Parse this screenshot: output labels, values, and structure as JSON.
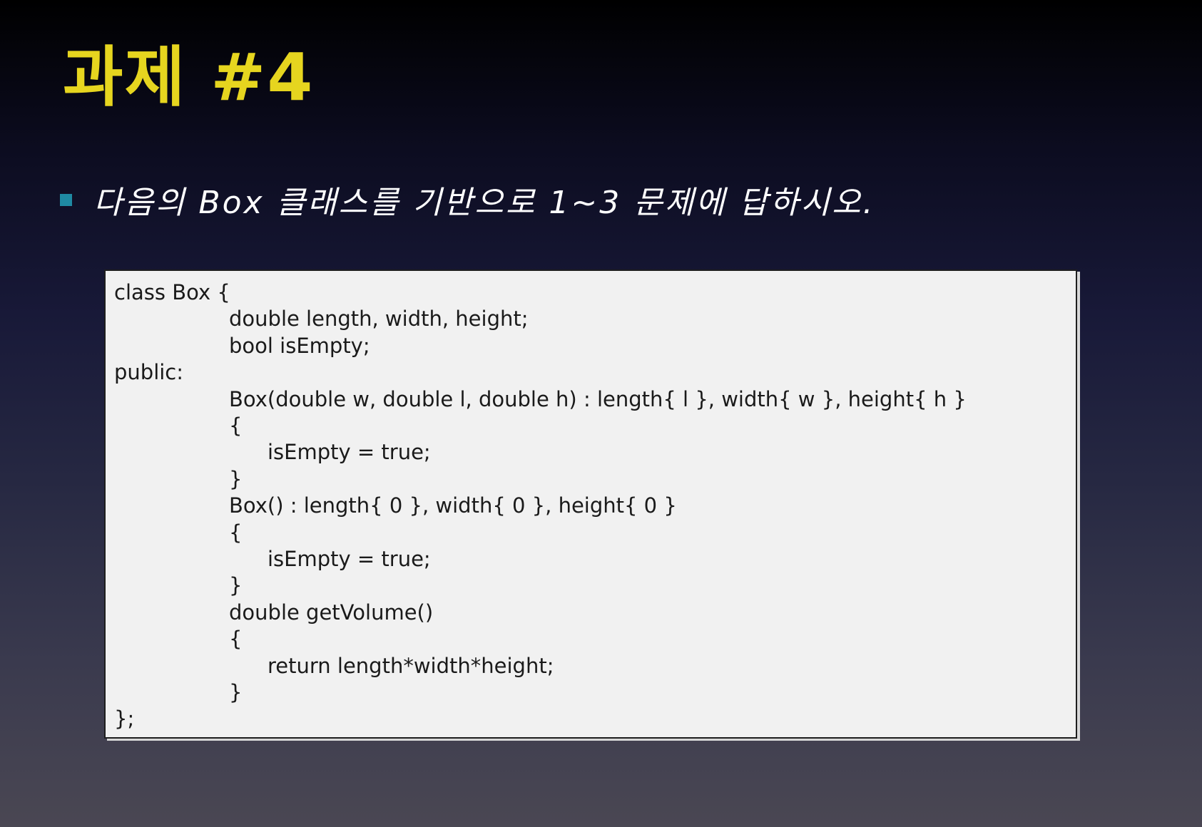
{
  "slide": {
    "title": "과제 #4",
    "bullet": "다음의 Box 클래스를 기반으로 1~3 문제에 답하시오."
  },
  "code": {
    "lines": [
      {
        "indent": 0,
        "text": "class Box {"
      },
      {
        "indent": 1,
        "text": "double length, width, height;"
      },
      {
        "indent": 1,
        "text": "bool isEmpty;"
      },
      {
        "indent": 0,
        "text": "public:"
      },
      {
        "indent": 1,
        "text": "Box(double w, double l, double h) : length{ l }, width{ w }, height{ h }"
      },
      {
        "indent": 1,
        "text": "{"
      },
      {
        "indent": 2,
        "text": "isEmpty = true;"
      },
      {
        "indent": 1,
        "text": "}"
      },
      {
        "indent": 1,
        "text": "Box() : length{ 0 }, width{ 0 }, height{ 0 }"
      },
      {
        "indent": 1,
        "text": "{"
      },
      {
        "indent": 2,
        "text": "isEmpty = true;"
      },
      {
        "indent": 1,
        "text": "}"
      },
      {
        "indent": 1,
        "text": "double getVolume()"
      },
      {
        "indent": 1,
        "text": "{"
      },
      {
        "indent": 2,
        "text": "return length*width*height;"
      },
      {
        "indent": 1,
        "text": "}"
      },
      {
        "indent": 0,
        "text": "};"
      }
    ]
  }
}
